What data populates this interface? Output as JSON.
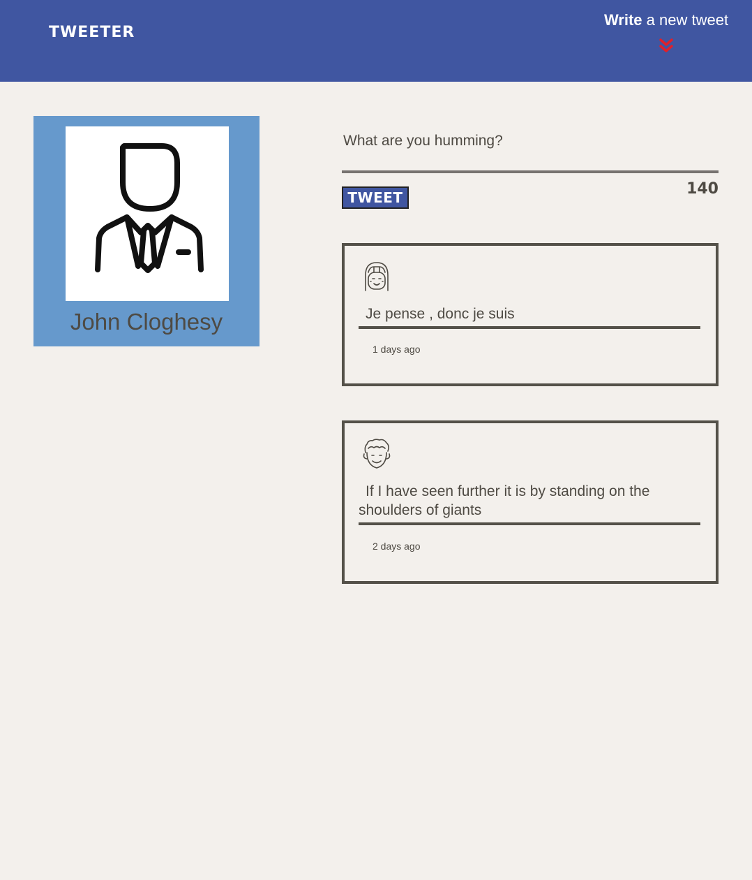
{
  "nav": {
    "brand": "TWEETER",
    "compose_bold": "Write",
    "compose_rest": " a new tweet",
    "arrow_color": "#e0202a",
    "background": "#4056a1"
  },
  "profile": {
    "name": "John Cloghesy",
    "avatar_icon": "businessman-icon",
    "background": "#6699cc"
  },
  "composer": {
    "placeholder": "What are you humming?",
    "value": "",
    "button_label": "TWEET",
    "counter": "140"
  },
  "tweets": [
    {
      "avatar_icon": "girl-face-icon",
      "text": "Je pense , donc je suis",
      "age": "1 days ago"
    },
    {
      "avatar_icon": "curly-hair-face-icon",
      "text": "If I have seen further it is by standing on the shoulders of giants",
      "age": "2 days ago"
    }
  ]
}
